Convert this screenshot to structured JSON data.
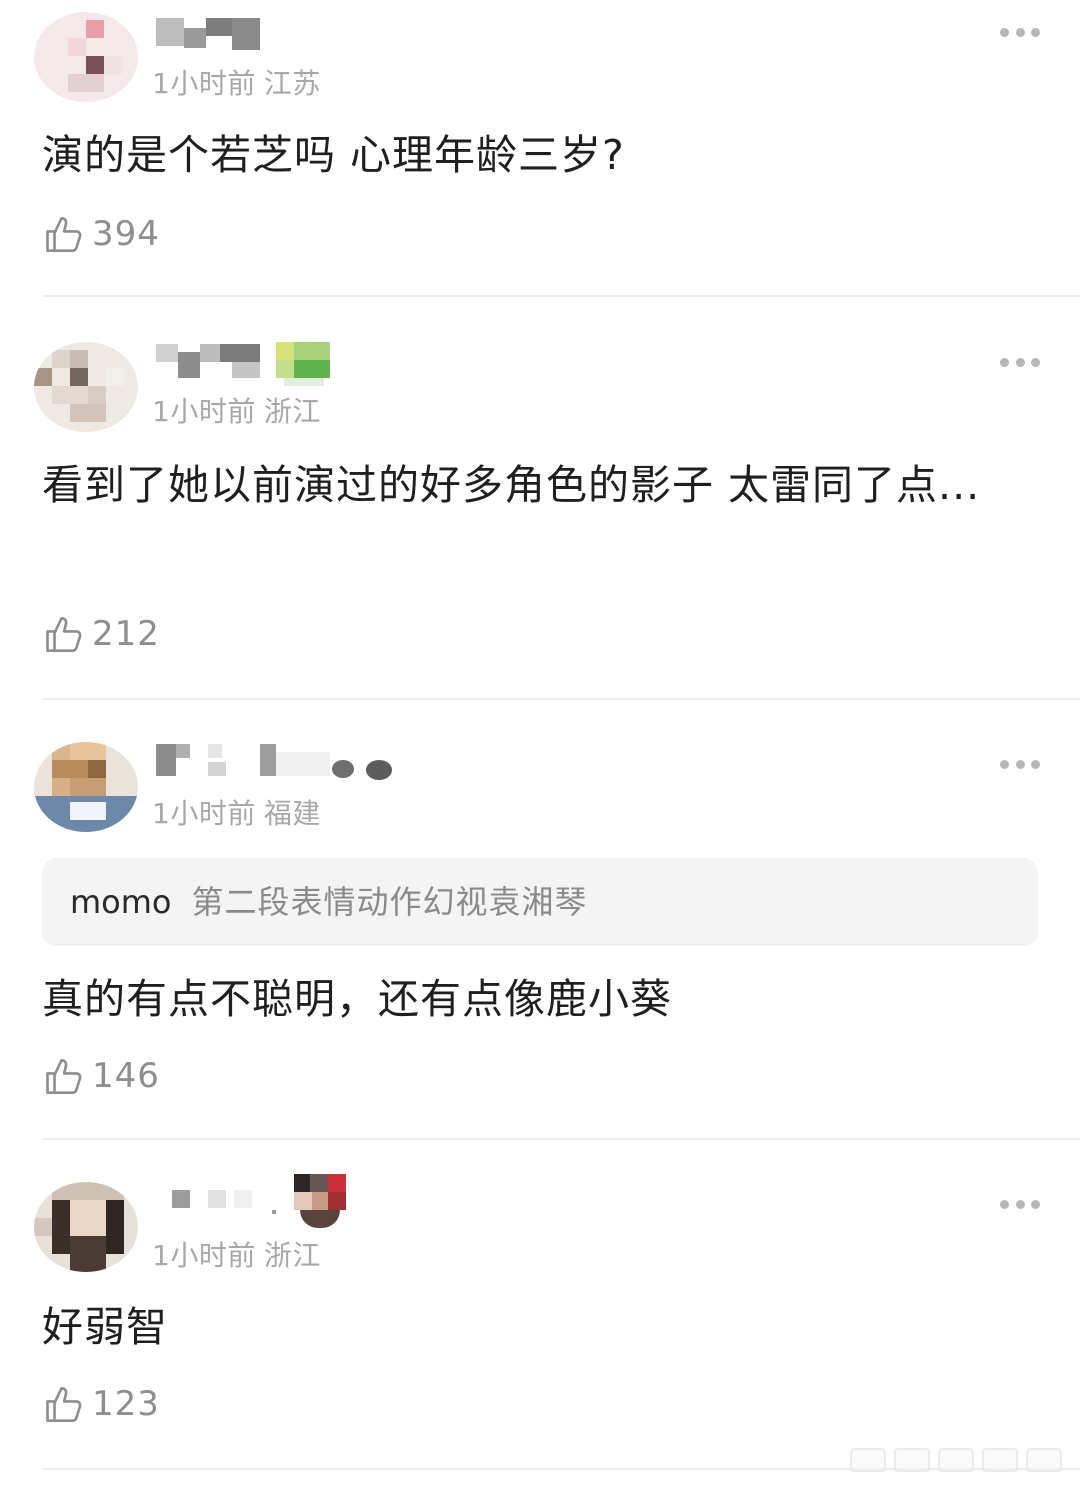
{
  "comments": [
    {
      "time": "1小时前",
      "region": "江苏",
      "text": "演的是个若芝吗 心理年龄三岁?",
      "likes": "394"
    },
    {
      "time": "1小时前",
      "region": "浙江",
      "text": "看到了她以前演过的好多角色的影子  太雷同了点...",
      "likes": "212"
    },
    {
      "time": "1小时前",
      "region": "福建",
      "quote_user": "momo",
      "quote_text": "第二段表情动作幻视袁湘琴",
      "text": "真的有点不聪明，还有点像鹿小葵",
      "likes": "146"
    },
    {
      "time": "1小时前",
      "region": "浙江",
      "text": "好弱智",
      "likes": "123"
    }
  ],
  "icons": {
    "like": "thumbs-up-icon",
    "more": "more-horizontal-icon"
  },
  "colors": {
    "text": "#1f1f1f",
    "meta": "#a8a8a8",
    "like_count": "#8e8e8e",
    "quote_bg": "#f4f4f4",
    "divider": "#ededed"
  }
}
